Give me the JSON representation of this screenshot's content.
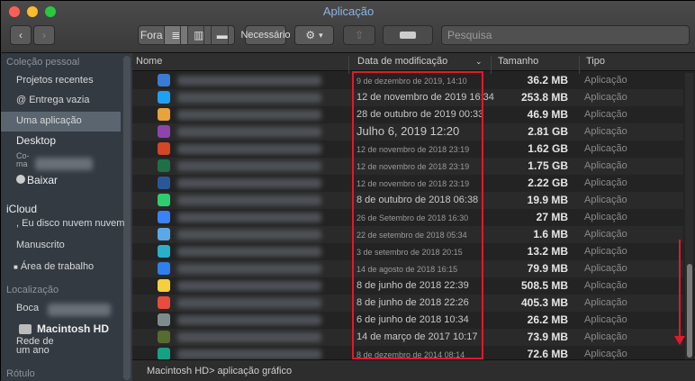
{
  "window": {
    "title": "Aplicação"
  },
  "toolbar": {
    "view_label": "Fora",
    "arrange_label": "Necessário",
    "search_placeholder": "Pesquisa"
  },
  "sidebar": {
    "sections": {
      "personal": "Coleção pessoal",
      "icloud": "iCloud",
      "location": "Localização",
      "label": "Rótulo"
    },
    "items": {
      "recents": "Projetos recentes",
      "airdrop": "@ Entrega vazia",
      "applications": "Uma aplicação",
      "desktop": "Desktop",
      "co_ma": "Co-\nma",
      "downloads": "Baixar",
      "icloud_drive": ", Eu disco nuvem nuvem",
      "documents": "Manuscrito",
      "icloud_desktop": "Área de trabalho",
      "boca": "Boca",
      "macintosh": "Macintosh HD",
      "network": "Rede de\num ano"
    }
  },
  "columns": {
    "name": "Nome",
    "date": "Data de modificação",
    "size": "Tamanho",
    "type": "Tipo"
  },
  "rows": [
    {
      "date": "9 de dezembro de 2019, 14:10",
      "size": "36.2 MB",
      "type": "Aplicação",
      "style": "sm",
      "icon_color": "#3a7bd5"
    },
    {
      "date": "12 de novembro de 2019 16:34",
      "size": "253.8 MB",
      "type": "Aplicação",
      "style": "",
      "icon_color": "#1ea1f2"
    },
    {
      "date": "28 de outubro de 2019 00:33",
      "size": "46.9 MB",
      "type": "Aplicação",
      "style": "",
      "icon_color": "#e8a33d"
    },
    {
      "date": "Julho 6, 2019 12:20",
      "size": "2.81 GB",
      "type": "Aplicação",
      "style": "lg",
      "icon_color": "#8e44ad"
    },
    {
      "date": "12 de novembro de 2018 23:19",
      "size": "1.62 GB",
      "type": "Aplicação",
      "style": "sm",
      "icon_color": "#d24726"
    },
    {
      "date": "12 de novembro de 2018 23:19",
      "size": "1.75 GB",
      "type": "Aplicação",
      "style": "sm",
      "icon_color": "#1e7145"
    },
    {
      "date": "12 de novembro de 2018 23:19",
      "size": "2.22 GB",
      "type": "Aplicação",
      "style": "sm",
      "icon_color": "#2b579a"
    },
    {
      "date": "8 de outubro de 2018 06:38",
      "size": "19.9 MB",
      "type": "Aplicação",
      "style": "",
      "icon_color": "#2ecc71"
    },
    {
      "date": "26 de Setembro de 2018 16:30",
      "size": "27 MB",
      "type": "Aplicação",
      "style": "sm",
      "icon_color": "#3b82f6"
    },
    {
      "date": "22 de setembro de 2018 05:34",
      "size": "1.6 MB",
      "type": "Aplicação",
      "style": "sm",
      "icon_color": "#5aa9e6"
    },
    {
      "date": "3 de setembro de 2018 20:15",
      "size": "13.2 MB",
      "type": "Aplicação",
      "style": "sm",
      "icon_color": "#27b1c9"
    },
    {
      "date": "14 de agosto de 2018 16:15",
      "size": "79.9 MB",
      "type": "Aplicação",
      "style": "sm",
      "icon_color": "#2f80ed"
    },
    {
      "date": "8 de junho de 2018 22:39",
      "size": "508.5 MB",
      "type": "Aplicação",
      "style": "",
      "icon_color": "#f4d03f"
    },
    {
      "date": "8 de junho de 2018 22:26",
      "size": "405.3 MB",
      "type": "Aplicação",
      "style": "",
      "icon_color": "#e74c3c"
    },
    {
      "date": "6 de junho de 2018 10:34",
      "size": "26.2 MB",
      "type": "Aplicação",
      "style": "",
      "icon_color": "#7f8c8d"
    },
    {
      "date": "14 de março de 2017 10:17",
      "size": "73.9 MB",
      "type": "Aplicação",
      "style": "",
      "icon_color": "#556b2f"
    },
    {
      "date": "8 de dezembro de 2014 08:14",
      "size": "72.6 MB",
      "type": "Aplicação",
      "style": "sm",
      "icon_color": "#16a085"
    }
  ],
  "pathbar": {
    "text": "Macintosh HD> aplicação gráfico"
  },
  "colors": {
    "highlight": "#e0192b",
    "sidebar_bg": "#333a42"
  }
}
